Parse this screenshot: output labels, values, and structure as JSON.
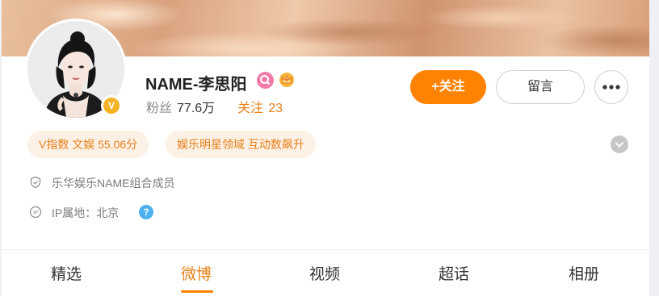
{
  "profile": {
    "name": "NAME-李思阳",
    "verified_badge": "V",
    "stats": {
      "fans_label": "粉丝",
      "fans_value": "77.6万",
      "following_label": "关注",
      "following_value": "23"
    },
    "icons": [
      "search-badge-icon",
      "crown-badge-icon"
    ]
  },
  "actions": {
    "follow_label": "+关注",
    "message_label": "留言",
    "more_icon": "more-dots-icon"
  },
  "tags": [
    {
      "label": "V指数 文娱 55.06分"
    },
    {
      "label": "娱乐明星领域 互动数飙升"
    }
  ],
  "info": {
    "org": "乐华娱乐NAME组合成员",
    "ip_location": "IP属地：北京",
    "help": "?"
  },
  "tabs": [
    {
      "label": "精选",
      "active": false
    },
    {
      "label": "微博",
      "active": true
    },
    {
      "label": "视频",
      "active": false
    },
    {
      "label": "超话",
      "active": false
    },
    {
      "label": "相册",
      "active": false
    }
  ],
  "colors": {
    "accent": "#ff8200",
    "accent_text": "#e7801a",
    "tag_bg": "#fdf1e6",
    "help": "#4eb0ee",
    "verified": "#f5b325"
  }
}
